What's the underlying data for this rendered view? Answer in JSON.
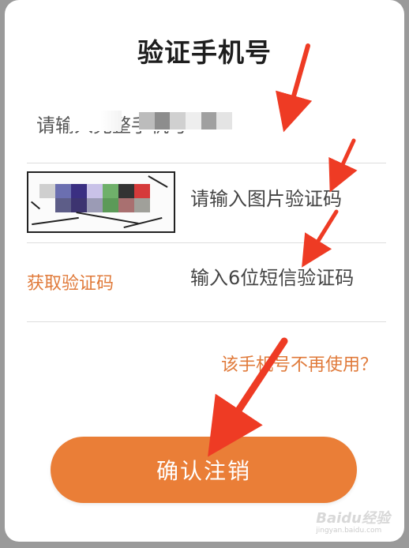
{
  "dialog": {
    "title": "验证手机号",
    "phone": {
      "placeholder": "请输入完整手机号",
      "visible_prefix": "请输",
      "visible_suffix": "完整手机号"
    },
    "captcha": {
      "placeholder": "请输入图片验证码",
      "image_icon": "captcha-image"
    },
    "sms": {
      "get_code_label": "获取验证码",
      "placeholder": "输入6位短信验证码"
    },
    "no_longer_use_link": "该手机号不再使用？",
    "confirm_button": "确认注销"
  },
  "watermark": {
    "text": "Baidu经验",
    "sub": "jingyan.baidu.com"
  },
  "colors": {
    "accent": "#ea7e37",
    "link": "#e07a3a",
    "arrow": "#ee3b24",
    "title": "#1e1e1e"
  }
}
